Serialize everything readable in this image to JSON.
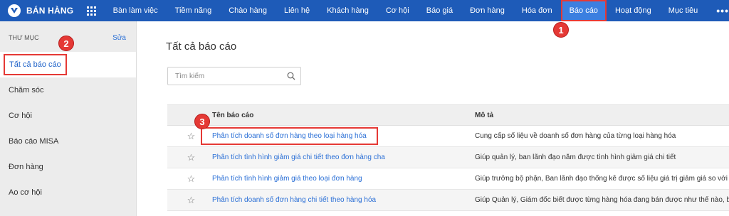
{
  "app": {
    "name": "BÁN HÀNG"
  },
  "nav": {
    "items": [
      {
        "label": "Bàn làm việc"
      },
      {
        "label": "Tiềm năng"
      },
      {
        "label": "Chào hàng"
      },
      {
        "label": "Liên hệ"
      },
      {
        "label": "Khách hàng"
      },
      {
        "label": "Cơ hội"
      },
      {
        "label": "Báo giá"
      },
      {
        "label": "Đơn hàng"
      },
      {
        "label": "Hóa đơn"
      },
      {
        "label": "Báo cáo",
        "active": true
      },
      {
        "label": "Hoạt động"
      },
      {
        "label": "Mục tiêu"
      }
    ],
    "more": "•••"
  },
  "annotations": {
    "step1": "1",
    "step2": "2",
    "step3": "3"
  },
  "sidebar": {
    "header": "THƯ MỤC",
    "edit": "Sửa",
    "items": [
      {
        "label": "Tất cả báo cáo",
        "active": true
      },
      {
        "label": "Chăm sóc"
      },
      {
        "label": "Cơ hội"
      },
      {
        "label": "Báo cáo MISA"
      },
      {
        "label": "Đơn hàng"
      },
      {
        "label": "Ao cơ hội"
      }
    ]
  },
  "main": {
    "title": "Tất cả báo cáo",
    "search": {
      "placeholder": "Tìm kiếm",
      "value": ""
    },
    "table": {
      "columns": {
        "name": "Tên báo cáo",
        "description": "Mô tả"
      },
      "rows": [
        {
          "name": "Phân tích doanh số đơn hàng theo loại hàng hóa",
          "description": "Cung cấp số liệu về doanh số đơn hàng của từng loại hàng hóa"
        },
        {
          "name": "Phân tích tình hình giảm giá chi tiết theo đơn hàng cha",
          "description": "Giúp quản lý, ban lãnh đạo nắm được tình hình giảm giá chi tiết"
        },
        {
          "name": "Phân tích tình hình giảm giá theo loại đơn hàng",
          "description": "Giúp trưởng bộ phận, Ban lãnh đạo thống kê được số liệu giá trị giảm giá so với"
        },
        {
          "name": "Phân tích doanh số đơn hàng chi tiết theo hàng hóa",
          "description": "Giúp Quản lý, Giám đốc biết được từng hàng hóa đang bán được như thế nào, b"
        }
      ]
    },
    "star": "☆"
  },
  "colors": {
    "topbar": "#1e5bb8",
    "accent": "#2a6fd6",
    "highlight": "#e53935"
  }
}
